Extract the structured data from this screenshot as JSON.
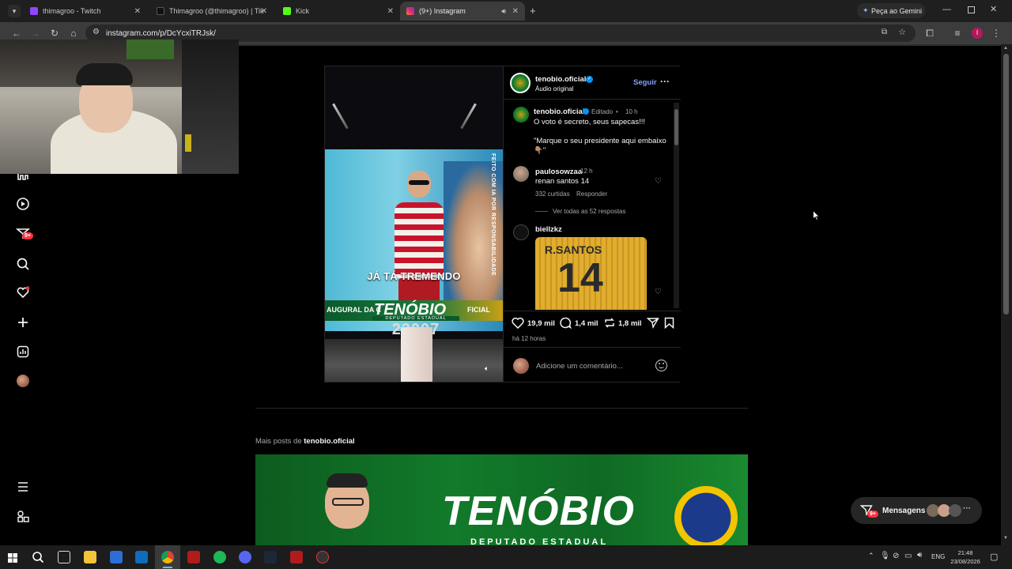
{
  "browser": {
    "tabs": [
      {
        "label": "thimagroo - Twitch",
        "color": "#9146ff"
      },
      {
        "label": "Thimagroo (@thimagroo) | Tik",
        "color": "#111111"
      },
      {
        "label": "Kick",
        "color": "#53fc18"
      },
      {
        "label": "(9+) Instagram",
        "color": "#e1306c"
      }
    ],
    "new_tab": "+",
    "gemini_label": "Peça ao Gemini",
    "url": "instagram.com/p/DcYcxiTRJsk/",
    "profile_initial": "I"
  },
  "nav": {
    "notifications_badge": "9+"
  },
  "post": {
    "author": "tenobio.oficial",
    "audio": "Áudio original",
    "follow": "Seguir",
    "more": "···",
    "caption": {
      "author": "tenobio.oficial",
      "edited": "Editado",
      "time": "10 h",
      "line1": "O voto é secreto, seus sapecas!!!",
      "line2": "\"Marque o seu presidente aqui embaixo 👇🏽\""
    },
    "comments": [
      {
        "user": "paulosowzaa",
        "time": "12 h",
        "text": "renan santos 14",
        "likes": "332 curtidas",
        "reply": "Responder",
        "view_replies": "Ver todas as 52 respostas"
      },
      {
        "user": "biellzkz",
        "image_text_top": "R.SANTOS",
        "image_text_number": "14"
      }
    ],
    "video": {
      "side_text": "FEITO COM IA POR RESPONSABILIDADE",
      "caption": "JÁ TÁ TREMENDO",
      "banner_left": "AUGURAL DA C",
      "banner_brand": "TENÓBIO",
      "banner_right": "FICIAL",
      "banner_sub": "DEPUTADO ESTADUAL",
      "number": "22007"
    },
    "stats": {
      "likes": "19,9 mil",
      "comments": "1,4 mil",
      "reposts": "1,8 mil",
      "time_ago": "há 12 horas"
    },
    "comment_placeholder": "Adicione um comentário..."
  },
  "more_posts": {
    "prefix": "Mais posts de",
    "user": "tenobio.oficial",
    "thumb_brand": "TENÓBIO",
    "thumb_sub": "DEPUTADO ESTADUAL"
  },
  "messages": {
    "label": "Mensagens",
    "badge": "9+",
    "more": "···"
  },
  "taskbar": {
    "lang": "ENG",
    "time": "21:48",
    "date": "23/08/2026"
  }
}
